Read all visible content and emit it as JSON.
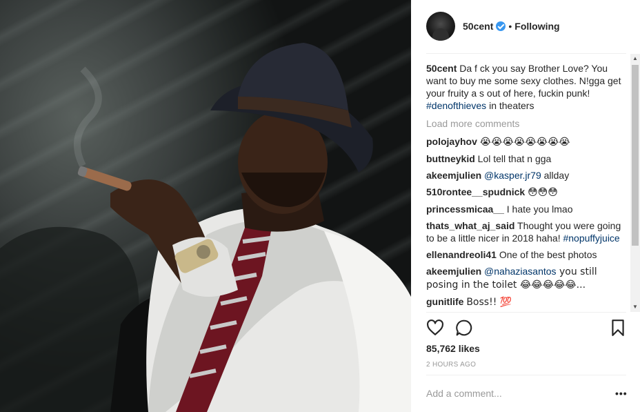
{
  "post": {
    "username": "50cent",
    "follow_status": "Following",
    "separator": "•",
    "caption_user": "50cent",
    "caption_text": "Da f ck you say Brother Love? You want to buy me some sexy clothes. N!gga get your fruity a s out of here, fuckin punk! ",
    "caption_hashtag": "#denofthieves",
    "caption_suffix": " in theaters",
    "load_more": "Load more comments"
  },
  "comments": [
    {
      "user": "polojayhov",
      "text": "😭😭😭😭😭😭😭😭"
    },
    {
      "user": "buttneykid",
      "text": "Lol tell that n gga"
    },
    {
      "user": "akeemjulien",
      "mention": "@kasper.jr79",
      "text": " allday"
    },
    {
      "user": "510rontee__spudnick",
      "text": "😳😳😳"
    },
    {
      "user": "princessmicaa__",
      "text": "I hate you lmao"
    },
    {
      "user": "thats_what_aj_said",
      "text": "Thought you were going to be a little nicer in 2018 haha! ",
      "hashtag": "#nopuffyjuice"
    },
    {
      "user": "ellenandreoli41",
      "text": "One of the best photos"
    },
    {
      "user": "akeemjulien",
      "mention": "@nahaziasantos",
      "text": " you still posing in the toilet 😂😂😂😂😂..."
    },
    {
      "user": "gunitlife",
      "text": "Boss!! 💯"
    }
  ],
  "engagement": {
    "likes": "85,762 likes",
    "time": "2 HOURS AGO"
  },
  "composer": {
    "placeholder": "Add a comment...",
    "more": "•••"
  },
  "icons": {
    "like": "heart-icon",
    "comment": "speech-bubble-icon",
    "save": "bookmark-icon",
    "verified": "verified-badge-icon"
  },
  "colors": {
    "hashtag": "#003569",
    "muted": "#999999",
    "verified": "#3897f0"
  }
}
